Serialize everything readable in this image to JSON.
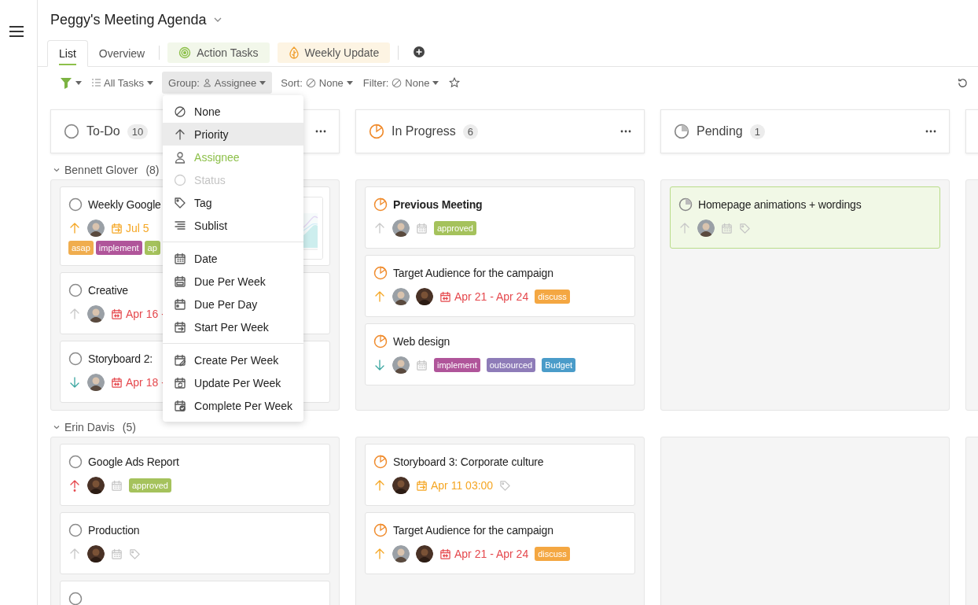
{
  "window": {
    "title": "Peggy's Meeting Agenda"
  },
  "tabs": [
    {
      "label": "List",
      "kind": "view",
      "selected": true
    },
    {
      "label": "Overview",
      "kind": "view",
      "selected": false
    },
    {
      "label": "Action Tasks",
      "kind": "target",
      "selected": false
    },
    {
      "label": "Weekly Update",
      "kind": "leaf",
      "selected": false
    }
  ],
  "toolbar": {
    "views": "All Tasks",
    "group": {
      "label": "Group:",
      "value": "Assignee",
      "open": true
    },
    "sort": {
      "label": "Sort:",
      "value": "None"
    },
    "filter": {
      "label": "Filter:",
      "value": "None"
    }
  },
  "group_menu": [
    [
      {
        "label": "None",
        "kind": "none",
        "selected": false,
        "hovered": false,
        "disabled": false
      },
      {
        "label": "Priority",
        "kind": "priority",
        "selected": false,
        "hovered": true,
        "disabled": false
      },
      {
        "label": "Assignee",
        "kind": "assignee",
        "selected": true,
        "hovered": false,
        "disabled": false
      },
      {
        "label": "Status",
        "kind": "status",
        "selected": false,
        "hovered": false,
        "disabled": true
      },
      {
        "label": "Tag",
        "kind": "tag",
        "selected": false,
        "hovered": false,
        "disabled": false
      },
      {
        "label": "Sublist",
        "kind": "sublist",
        "selected": false,
        "hovered": false,
        "disabled": false
      }
    ],
    [
      {
        "label": "Date",
        "kind": "date",
        "selected": false,
        "hovered": false,
        "disabled": false
      },
      {
        "label": "Due Per Week",
        "kind": "dueweek",
        "selected": false,
        "hovered": false,
        "disabled": false
      },
      {
        "label": "Due Per Day",
        "kind": "dueday",
        "selected": false,
        "hovered": false,
        "disabled": false
      },
      {
        "label": "Start Per Week",
        "kind": "startweek",
        "selected": false,
        "hovered": false,
        "disabled": false
      }
    ],
    [
      {
        "label": "Create Per Week",
        "kind": "createweek",
        "selected": false,
        "hovered": false,
        "disabled": false
      },
      {
        "label": "Update Per Week",
        "kind": "updateweek",
        "selected": false,
        "hovered": false,
        "disabled": false
      },
      {
        "label": "Complete Per Week",
        "kind": "completeweek",
        "selected": false,
        "hovered": false,
        "disabled": false
      }
    ]
  ],
  "columns": [
    {
      "title": "To-Do",
      "count": "10",
      "kind": "todo"
    },
    {
      "title": "In Progress",
      "count": "6",
      "kind": "progress"
    },
    {
      "title": "Pending",
      "count": "1",
      "kind": "pending"
    },
    {
      "kind": "other"
    }
  ],
  "groups": [
    {
      "name": "Bennett Glover",
      "count": "(8)",
      "expanded": true,
      "lanes": [
        {
          "cards": [
            {
              "title": "Weekly Google",
              "kind": "todo",
              "priority": {
                "kind": "high"
              },
              "avatars": [
                {
                  "kind": "light"
                }
              ],
              "date": {
                "text": "Jul 5",
                "kind": "soon"
              },
              "tags": [
                {
                  "label": "asap",
                  "color": "#f0ad4e"
                },
                {
                  "label": "implement",
                  "color": "#b0559a"
                },
                {
                  "label": "ap",
                  "color": "#a5c25c"
                }
              ],
              "thumbnail": {
                "kind": "picture"
              },
              "selected": false,
              "bold": false
            },
            {
              "title": "Creative",
              "kind": "todo",
              "priority": {
                "kind": "none"
              },
              "avatars": [
                {
                  "kind": "light"
                }
              ],
              "date": {
                "text": "Apr 16 -",
                "kind": "overdue"
              },
              "selected": false,
              "bold": false
            },
            {
              "title": "Storyboard 2:",
              "kind": "todo",
              "priority": {
                "kind": "low"
              },
              "avatars": [
                {
                  "kind": "light"
                }
              ],
              "date": {
                "text": "Apr 18 -",
                "kind": "overdue"
              },
              "selected": false,
              "bold": false
            }
          ]
        },
        {
          "cards": [
            {
              "title": "Previous Meeting",
              "kind": "progress",
              "priority": {
                "kind": "none"
              },
              "avatars": [
                {
                  "kind": "light"
                }
              ],
              "tags": [
                {
                  "label": "approved",
                  "color": "#a5c25c"
                }
              ],
              "selected": false,
              "bold": true
            },
            {
              "title": "Target Audience for the campaign",
              "kind": "progress",
              "priority": {
                "kind": "high"
              },
              "avatars": [
                {
                  "kind": "light"
                },
                {
                  "kind": "dark"
                }
              ],
              "date": {
                "text": "Apr 21 - Apr 24",
                "kind": "overdue"
              },
              "tags": [
                {
                  "label": "discuss",
                  "color": "#f4a742"
                }
              ],
              "selected": false,
              "bold": false
            },
            {
              "title": "Web design",
              "kind": "progress",
              "priority": {
                "kind": "low"
              },
              "avatars": [
                {
                  "kind": "light"
                }
              ],
              "tags": [
                {
                  "label": "implement",
                  "color": "#b0559a"
                },
                {
                  "label": "outsourced",
                  "color": "#8e7cb8"
                },
                {
                  "label": "Budget",
                  "color": "#4a9cc9"
                }
              ],
              "selected": false,
              "bold": false
            }
          ]
        },
        {
          "cards": [
            {
              "title": "Homepage animations + wordings",
              "kind": "pending",
              "priority": {
                "kind": "none"
              },
              "avatars": [
                {
                  "kind": "light"
                }
              ],
              "tag_icon": true,
              "selected": true,
              "bold": false
            }
          ]
        }
      ]
    },
    {
      "name": "Erin Davis",
      "count": "(5)",
      "expanded": true,
      "lanes": [
        {
          "cards": [
            {
              "title": "Google Ads Report",
              "kind": "todo",
              "priority": {
                "kind": "urgent"
              },
              "avatars": [
                {
                  "kind": "dark"
                }
              ],
              "tags": [
                {
                  "label": "approved",
                  "color": "#a5c25c"
                }
              ],
              "selected": false,
              "bold": false
            },
            {
              "title": "Production",
              "kind": "todo",
              "priority": {
                "kind": "none"
              },
              "avatars": [
                {
                  "kind": "dark"
                }
              ],
              "tag_icon": true,
              "selected": false,
              "bold": false
            },
            {
              "kind": "todo",
              "selected": false
            }
          ]
        },
        {
          "cards": [
            {
              "title": "Storyboard 3: Corporate culture",
              "kind": "progress",
              "priority": {
                "kind": "high"
              },
              "avatars": [
                {
                  "kind": "dark"
                }
              ],
              "date": {
                "text": "Apr 11  03:00",
                "kind": "soon"
              },
              "tag_icon": true,
              "selected": false,
              "bold": false
            },
            {
              "title": "Target Audience for the campaign",
              "kind": "progress",
              "priority": {
                "kind": "high"
              },
              "avatars": [
                {
                  "kind": "light"
                },
                {
                  "kind": "dark"
                }
              ],
              "date": {
                "text": "Apr 21 - Apr 24",
                "kind": "overdue"
              },
              "tags": [
                {
                  "label": "discuss",
                  "color": "#f4a742"
                }
              ],
              "selected": false,
              "bold": false
            }
          ]
        }
      ]
    }
  ]
}
